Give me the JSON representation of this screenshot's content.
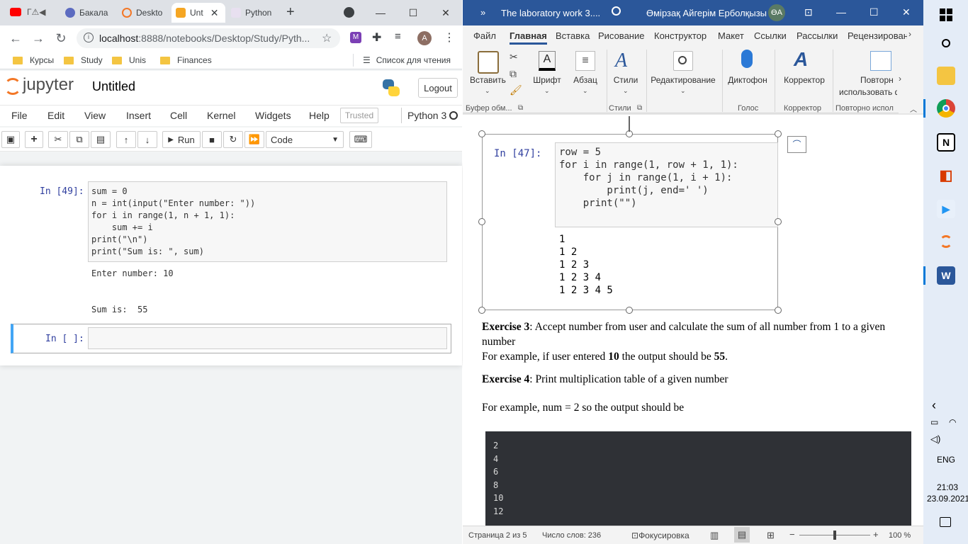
{
  "browser": {
    "tabs": [
      {
        "label": "Бакала"
      },
      {
        "label": "Deskto"
      },
      {
        "label": "Unt"
      },
      {
        "label": "Python"
      }
    ],
    "url_host": "localhost",
    "url_path": ":8888/notebooks/Desktop/Study/Pyth...",
    "profile_initial": "A",
    "bookmarks": [
      "Курсы",
      "Study",
      "Unis",
      "Finances"
    ],
    "reading_list": "Список для чтения"
  },
  "jupyter": {
    "logo_text": "jupyter",
    "notebook_name": "Untitled",
    "logout_label": "Logout",
    "menu": [
      "File",
      "Edit",
      "View",
      "Insert",
      "Cell",
      "Kernel",
      "Widgets",
      "Help"
    ],
    "trusted_label": "Trusted",
    "kernel_name": "Python 3",
    "run_label": "Run",
    "cell_type": "Code",
    "cell1_prompt": "In [49]:",
    "cell1_code": [
      "sum = 0",
      "n = int(input(\"Enter number: \"))",
      "for i in range(1, n + 1, 1):",
      "    sum += i",
      "print(\"\\n\")",
      "print(\"Sum is: \", sum)"
    ],
    "cell1_output": [
      "Enter number: 10",
      "",
      "",
      "Sum is:  55"
    ],
    "cell2_prompt": "In [ ]:"
  },
  "word": {
    "title": "The laboratory work 3....",
    "user_name": "Өмірзақ Айгерім Ерболқызы",
    "user_initials": "ӨА",
    "tabs": [
      "Файл",
      "Главная",
      "Вставка",
      "Рисование",
      "Конструктор",
      "Макет",
      "Ссылки",
      "Рассылки",
      "Рецензирован"
    ],
    "ribbon": {
      "paste": "Вставить",
      "font": "Шрифт",
      "paragraph": "Абзац",
      "styles": "Стили",
      "editing": "Редактирование",
      "dictate": "Диктофон",
      "editor": "Корректор",
      "reuse_line1": "Повторн",
      "reuse_line2": "использовать ф",
      "group_clipboard": "Буфер обм...",
      "group_styles": "Стили",
      "group_voice": "Голос",
      "group_editor": "Корректор",
      "group_reuse": "Повторно испол"
    },
    "doc": {
      "code_prompt": "In [47]:",
      "code_lines": [
        "row = 5",
        "for i in range(1, row + 1, 1):",
        "    for j in range(1, i + 1):",
        "        print(j, end=' ')",
        "    print(\"\")"
      ],
      "output_lines": [
        "1",
        "1 2",
        "1 2 3",
        "1 2 3 4",
        "1 2 3 4 5"
      ],
      "ex3_bold": "Exercise 3",
      "ex3_text": ": Accept number from user and calculate the sum of all number from 1 to a given number",
      "ex3_example_pre": "For example, if user entered ",
      "ex3_example_b1": "10",
      "ex3_example_mid": " the output should be ",
      "ex3_example_b2": "55",
      "ex3_example_end": ".",
      "ex4_bold": "Exercise 4",
      "ex4_text": ": Print multiplication table of a given number",
      "ex4_example": "For example, num = 2 so the output should be",
      "terminal_lines": [
        "2",
        "4",
        "6",
        "8",
        "10",
        "12"
      ]
    },
    "status": {
      "page": "Страница 2 из 5",
      "words": "Число слов: 236",
      "focus": "Фокусировка",
      "zoom": "100 %"
    }
  },
  "taskbar": {
    "lang": "ENG",
    "time": "21:03",
    "date": "23.09.2021"
  },
  "colors": {
    "word_blue": "#2b579a",
    "jupyter_orange": "#f37726",
    "jupyter_prompt": "#303f9f",
    "terminal_bg": "#2f3136"
  }
}
